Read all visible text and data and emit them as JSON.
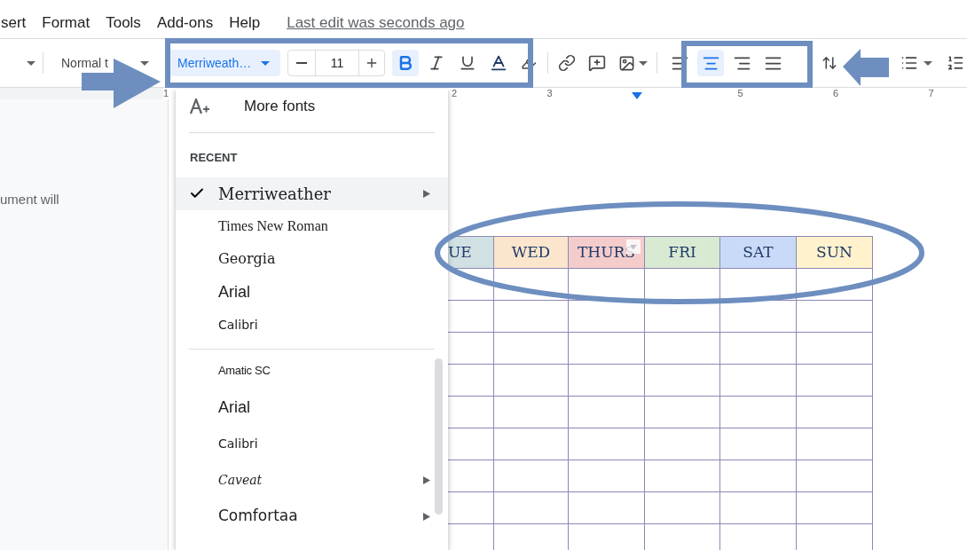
{
  "menu": [
    "sert",
    "Format",
    "Tools",
    "Add-ons",
    "Help"
  ],
  "last_edit": "Last edit was seconds ago",
  "toolbar": {
    "paragraph_style": "Normal t",
    "font": "Merriweath…",
    "font_size": "11",
    "format_buttons": [
      {
        "kind": "bold",
        "selected": true
      },
      {
        "kind": "italic",
        "selected": false
      },
      {
        "kind": "underline",
        "selected": false
      }
    ],
    "alignments": [
      {
        "kind": "left",
        "selected": false
      },
      {
        "kind": "center",
        "selected": true
      },
      {
        "kind": "right",
        "selected": false
      },
      {
        "kind": "justify",
        "selected": false
      }
    ]
  },
  "ruler": [
    {
      "kind": "number",
      "label": "1"
    },
    {
      "kind": "number",
      "label": "2"
    },
    {
      "kind": "number",
      "label": "3"
    },
    {
      "kind": "marker"
    },
    {
      "kind": "number",
      "label": "5"
    },
    {
      "kind": "number",
      "label": "6"
    },
    {
      "kind": "number",
      "label": "7"
    }
  ],
  "sidebar_text": "ument will",
  "font_menu": {
    "more_fonts": "More fonts",
    "section": "RECENT",
    "recent": [
      {
        "label": "Merriweather",
        "kind": "slab",
        "selected": true,
        "submenu": true
      },
      {
        "label": "Times New Roman",
        "kind": "classic",
        "selected": false,
        "submenu": false
      },
      {
        "label": "Georgia",
        "kind": "serif",
        "selected": false,
        "submenu": false
      },
      {
        "label": "Arial",
        "kind": "sans",
        "selected": false,
        "submenu": false
      },
      {
        "label": "Calibri",
        "kind": "light",
        "selected": false,
        "submenu": false
      }
    ],
    "fonts": [
      {
        "label": "Amatic SC",
        "kind": "condensed",
        "submenu": false
      },
      {
        "label": "Arial",
        "kind": "sans",
        "submenu": false
      },
      {
        "label": "Calibri",
        "kind": "light",
        "submenu": false
      },
      {
        "label": "Caveat",
        "kind": "script",
        "submenu": true
      },
      {
        "label": "Comfortaa",
        "kind": "rounded",
        "submenu": true
      }
    ]
  },
  "table": {
    "columns": [
      {
        "label": "UE",
        "color": "#d0e0e3"
      },
      {
        "label": "WED",
        "color": "#fce5cd"
      },
      {
        "label": "THURS",
        "color": "#f4cccc"
      },
      {
        "label": "FRI",
        "color": "#d9ead3"
      },
      {
        "label": "SAT",
        "color": "#c9daf8"
      },
      {
        "label": "SUN",
        "color": "#fff2cc"
      }
    ]
  }
}
